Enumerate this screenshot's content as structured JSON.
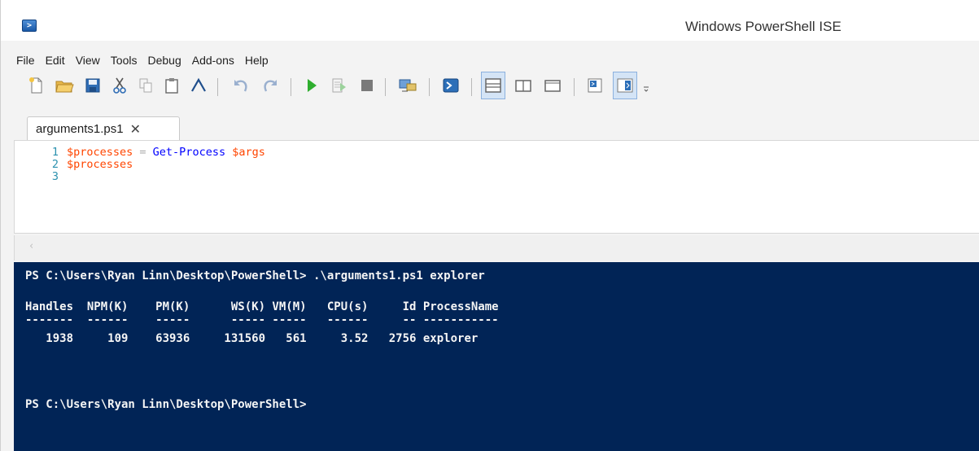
{
  "window": {
    "title": "Windows PowerShell ISE"
  },
  "menu": {
    "items": [
      "File",
      "Edit",
      "View",
      "Tools",
      "Debug",
      "Add-ons",
      "Help"
    ]
  },
  "toolbar": {
    "icons": [
      "new-file-icon",
      "open-folder-icon",
      "save-icon",
      "cut-icon",
      "copy-icon",
      "paste-icon",
      "clear-console-icon",
      "undo-icon",
      "redo-icon",
      "run-script-icon",
      "run-selection-icon",
      "stop-icon",
      "remote-powershell-icon",
      "powershell-console-icon",
      "layout-top-icon",
      "layout-right-icon",
      "layout-maximized-icon",
      "show-script-pane-icon",
      "show-command-addon-icon",
      "toolbar-overflow-icon"
    ]
  },
  "tabs": [
    {
      "label": "arguments1.ps1",
      "close": "✕"
    }
  ],
  "script": {
    "lines": [
      {
        "num": "1",
        "var": "$processes",
        "op": " = ",
        "cmd": "Get-Process",
        "arg": " $args"
      },
      {
        "num": "2",
        "var": "$processes"
      },
      {
        "num": "3"
      }
    ]
  },
  "console": {
    "command_line": "PS C:\\Users\\Ryan Linn\\Desktop\\PowerShell> .\\arguments1.ps1 explorer",
    "table_header": "Handles  NPM(K)    PM(K)      WS(K) VM(M)   CPU(s)     Id ProcessName",
    "table_rule": "-------  ------    -----      ----- -----   ------     -- -----------",
    "table_row": "   1938     109    63936     131560   561     3.52   2756 explorer",
    "prompt": "PS C:\\Users\\Ryan Linn\\Desktop\\PowerShell>"
  },
  "colors": {
    "console_bg": "#012456",
    "variable": "#ff4500",
    "cmdlet": "#0000ff",
    "line_number": "#2b91af"
  }
}
